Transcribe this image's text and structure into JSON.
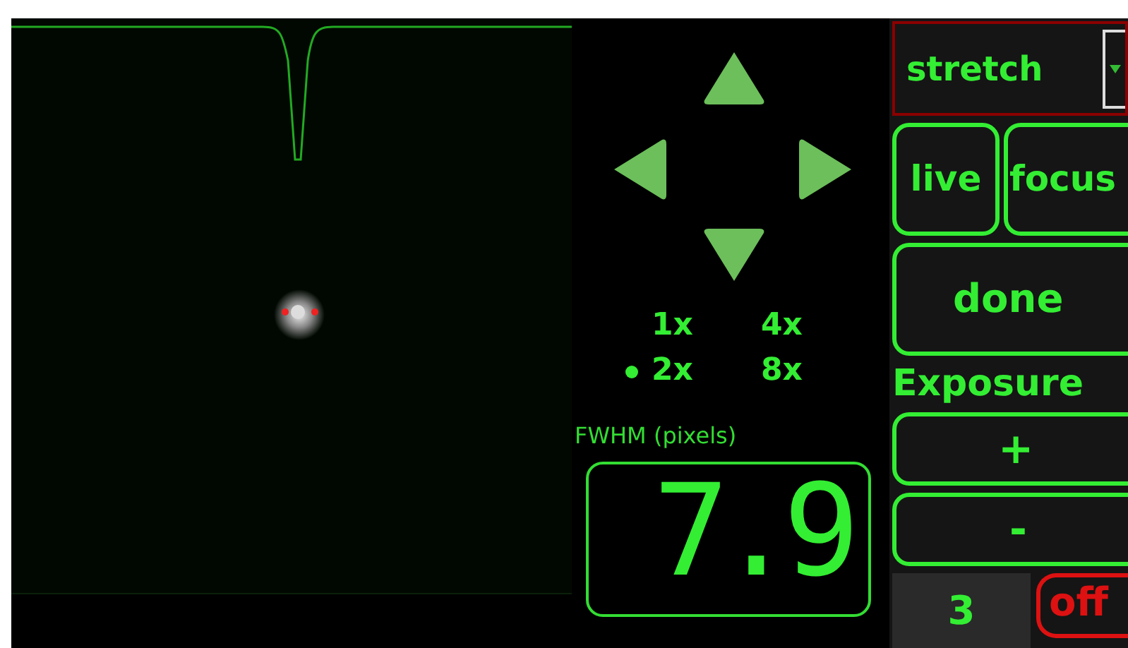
{
  "zoom_options": [
    {
      "label": "1x",
      "selected": false
    },
    {
      "label": "4x",
      "selected": false
    },
    {
      "label": "2x",
      "selected": true
    },
    {
      "label": "8x",
      "selected": false
    }
  ],
  "fwhm": {
    "label": "FWHM (pixels)",
    "value": "7.9"
  },
  "stretch_select": {
    "value": "stretch"
  },
  "mode_buttons": [
    {
      "label": "live"
    },
    {
      "label": "focus"
    }
  ],
  "done_button": {
    "label": "done"
  },
  "exposure": {
    "label": "Exposure",
    "increase": "+",
    "decrease": "-",
    "value": "3",
    "toggle": {
      "label": "off",
      "on": false
    }
  }
}
